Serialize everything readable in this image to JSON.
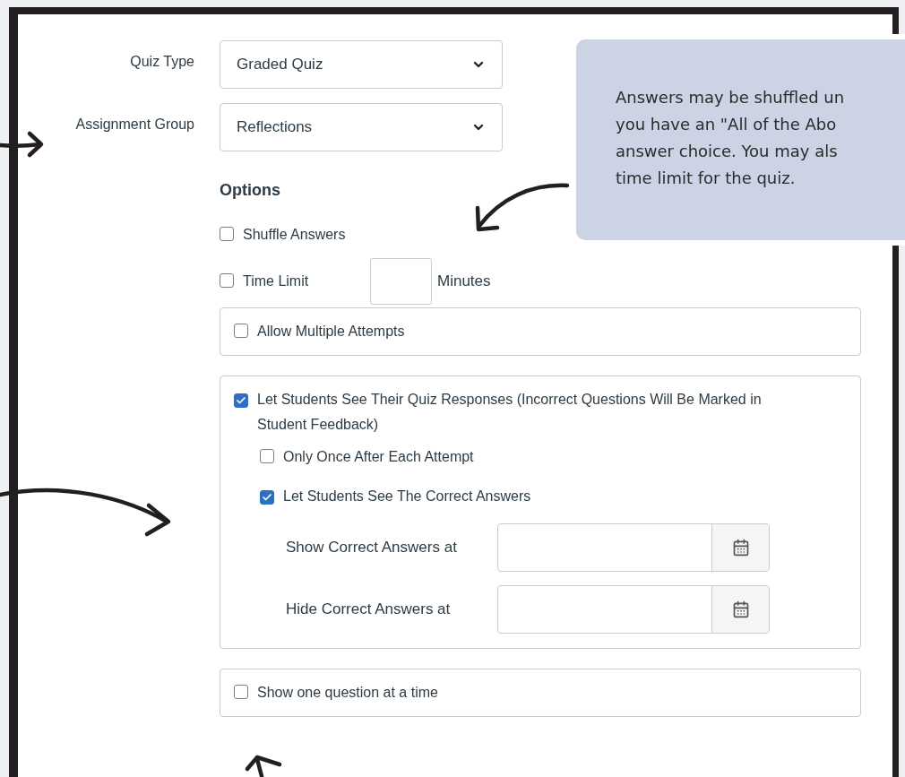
{
  "fields": [
    {
      "label": "Quiz Type",
      "value": "Graded Quiz"
    },
    {
      "label": "Assignment Group",
      "value": "Reflections"
    }
  ],
  "options": {
    "heading": "Options",
    "items": [
      {
        "kind": "checkbox",
        "label": "Shuffle Answers",
        "checked": false
      },
      {
        "kind": "timed",
        "label": "Time Limit",
        "checked": false,
        "unit": "Minutes"
      },
      {
        "kind": "panel",
        "label": "Allow Multiple Attempts",
        "checked": false
      },
      {
        "kind": "panel",
        "label": "Let Students See Their Quiz Responses (Incorrect Questions Will Be Marked in Student Feedback)",
        "checked": true,
        "children": [
          {
            "kind": "checkbox",
            "label": "Only Once After Each Attempt",
            "checked": false
          },
          {
            "kind": "checkbox",
            "label": "Let Students See The Correct Answers",
            "checked": true,
            "date_fields": [
              {
                "label": "Show Correct Answers at"
              },
              {
                "label": "Hide Correct Answers at"
              }
            ]
          }
        ]
      },
      {
        "kind": "panel",
        "label": "Show one question at a time",
        "checked": false
      }
    ]
  },
  "callout": {
    "lines": [
      "Answers may be shuffled un",
      "you have an \"All of the Abo",
      "answer choice. You may als",
      "time limit for the quiz."
    ]
  }
}
